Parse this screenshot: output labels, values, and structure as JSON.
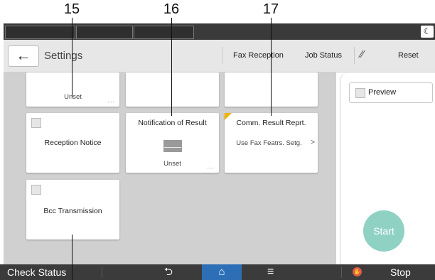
{
  "callouts": [
    "15",
    "16",
    "17"
  ],
  "header": {
    "back_symbol": "←",
    "title": "Settings",
    "fax_reception": "Fax Reception",
    "job_status": "Job Status",
    "wand_symbol": "⁄⁄",
    "reset": "Reset"
  },
  "topbar": {
    "moon_symbol": "☾"
  },
  "cards": {
    "top_left_sub": "Unset",
    "top_left_dots": "...",
    "reception_notice": "Reception Notice",
    "notification_title": "Notification of Result",
    "notification_sub": "Unset",
    "notification_dots": "...",
    "comm_title": "Comm. Result Reprt.",
    "comm_sub": "Use Fax Featrs. Setg.",
    "comm_chevron": ">",
    "bcc": "Bcc Transmission"
  },
  "right_panel": {
    "preview": "Preview",
    "start": "Start"
  },
  "bottombar": {
    "check_status": "Check Status",
    "back_symbol": "⮌",
    "home_symbol": "⌂",
    "menu_symbol": "≡",
    "stop": "Stop",
    "stop_icon": "✋"
  }
}
